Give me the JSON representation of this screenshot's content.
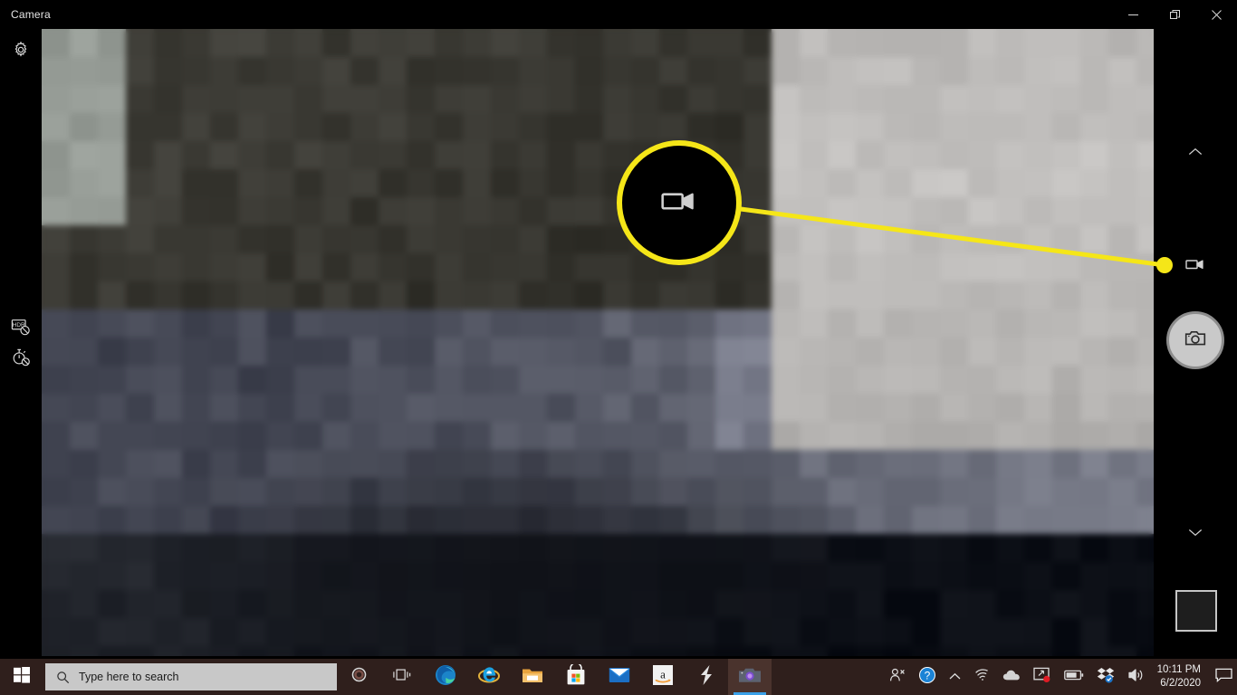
{
  "window": {
    "title": "Camera",
    "controls": {
      "minimize": "Minimize",
      "maximize": "Restore",
      "close": "Close"
    }
  },
  "left_rail": {
    "settings_label": "Settings",
    "hdr_label": "HDR off",
    "timer_label": "Photo timer off"
  },
  "right_rail": {
    "scroll_up_label": "Previous mode",
    "video_mode_label": "Take video",
    "photo_mode_label": "Take photo",
    "scroll_down_label": "Next mode",
    "gallery_label": "Recent photos"
  },
  "annotation": {
    "icon_label": "video-camera",
    "accent_color": "#f5e618",
    "target_label": "Take video button"
  },
  "taskbar": {
    "start_label": "Start",
    "search": {
      "placeholder": "Type here to search",
      "value": ""
    },
    "cortana_label": "Cortana",
    "taskview_label": "Task View",
    "apps": [
      {
        "name": "Microsoft Edge",
        "icon": "edge-icon",
        "active": false
      },
      {
        "name": "Internet Explorer",
        "icon": "internet-explorer-icon",
        "active": false
      },
      {
        "name": "File Explorer",
        "icon": "file-explorer-icon",
        "active": false
      },
      {
        "name": "Microsoft Store",
        "icon": "microsoft-store-icon",
        "active": false
      },
      {
        "name": "Mail",
        "icon": "mail-icon",
        "active": false
      },
      {
        "name": "Amazon",
        "icon": "amazon-icon",
        "active": false
      },
      {
        "name": "Lightning App",
        "icon": "lightning-s-icon",
        "active": false
      },
      {
        "name": "Camera",
        "icon": "camera-icon",
        "active": true
      }
    ],
    "tray": [
      {
        "name": "People",
        "icon": "people-icon"
      },
      {
        "name": "Get Help",
        "icon": "question-circle-icon"
      },
      {
        "name": "Show hidden icons",
        "icon": "chevron-up-icon"
      },
      {
        "name": "Network",
        "icon": "wifi-icon"
      },
      {
        "name": "OneDrive",
        "icon": "cloud-icon"
      },
      {
        "name": "Display settings",
        "icon": "monitor-alert-icon"
      },
      {
        "name": "Battery",
        "icon": "battery-icon"
      },
      {
        "name": "Dropbox",
        "icon": "dropbox-icon"
      },
      {
        "name": "Volume",
        "icon": "speaker-icon"
      }
    ],
    "clock": {
      "time": "10:11 PM",
      "date": "6/2/2020"
    },
    "notifications_label": "Notifications"
  },
  "preview": {
    "description": "Pixelated camera preview"
  }
}
